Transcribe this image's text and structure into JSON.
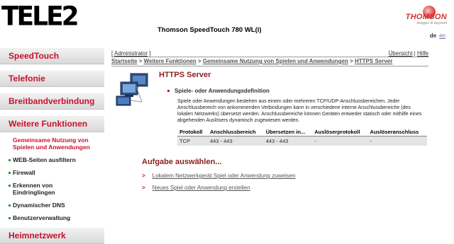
{
  "header": {
    "logo": "TELE2",
    "product_title": "Thomson SpeedTouch 780 WL(i)",
    "brand_name": "THOMSON",
    "brand_tagline": "images & beyond",
    "lang_active": "de",
    "lang_other": "en"
  },
  "sidebar": {
    "sections": [
      "SpeedTouch",
      "Telefonie",
      "Breitbandverbindung",
      "Weitere Funktionen",
      "Heimnetzwerk"
    ],
    "subitems": [
      "Gemeinsame Nutzung von Spielen und Anwendungen",
      "WEB-Seiten ausfiltern",
      "Firewall",
      "Erkennen von Eindringlingen",
      "Dynamischer DNS",
      "Benutzerverwaltung"
    ]
  },
  "toplinks": {
    "user_open": "[ ",
    "user": "Administrator",
    "user_close": " ]",
    "overview": "Übersicht",
    "sep": " | ",
    "help": "Hilfe"
  },
  "breadcrumb": {
    "items": [
      "Startseite",
      "Weitere Funktionen",
      "Gemeinsame Nutzung von Spielen und Anwendungen",
      "HTTPS Server"
    ],
    "sep": " > "
  },
  "main": {
    "title": "HTTPS Server",
    "section_label": "Spiele- oder Anwendungsdefinition",
    "description": "Spiele oder Anwendungen bestehen aus einem oder mehreren TCP/UDP-Anschlussbereichen. Jeder Anschlussbereich von ankommenden Verbindungen kann in verschiedene interne Anschlussbereiche (des lokalen Netzwerks) übersetzt werden. Anschlussbereiche können Geräten entweder statisch oder mithilfe eines abgehenden Auslösers dynamisch zugewiesen werden.",
    "table": {
      "headers": [
        "Protokoll",
        "Anschlussbereich",
        "Übersetzen in...",
        "Auslöserprotokoll",
        "Auslöseranschluss"
      ],
      "rows": [
        [
          "TCP",
          "443 - 443",
          "443 - 443",
          "-",
          "-"
        ]
      ]
    }
  },
  "tasks": {
    "title": "Aufgabe auswählen...",
    "arrow": ">",
    "items": [
      "Lokalem Netzwerkgerät Spiel oder Anwendung zuweisen",
      "Neues Spiel oder Anwendung erstellen"
    ]
  },
  "colors": {
    "accent_red": "#c8102e",
    "title_red": "#8a1f1f",
    "bullet_green": "#2a9a3a",
    "brand_red": "#d0322d"
  }
}
